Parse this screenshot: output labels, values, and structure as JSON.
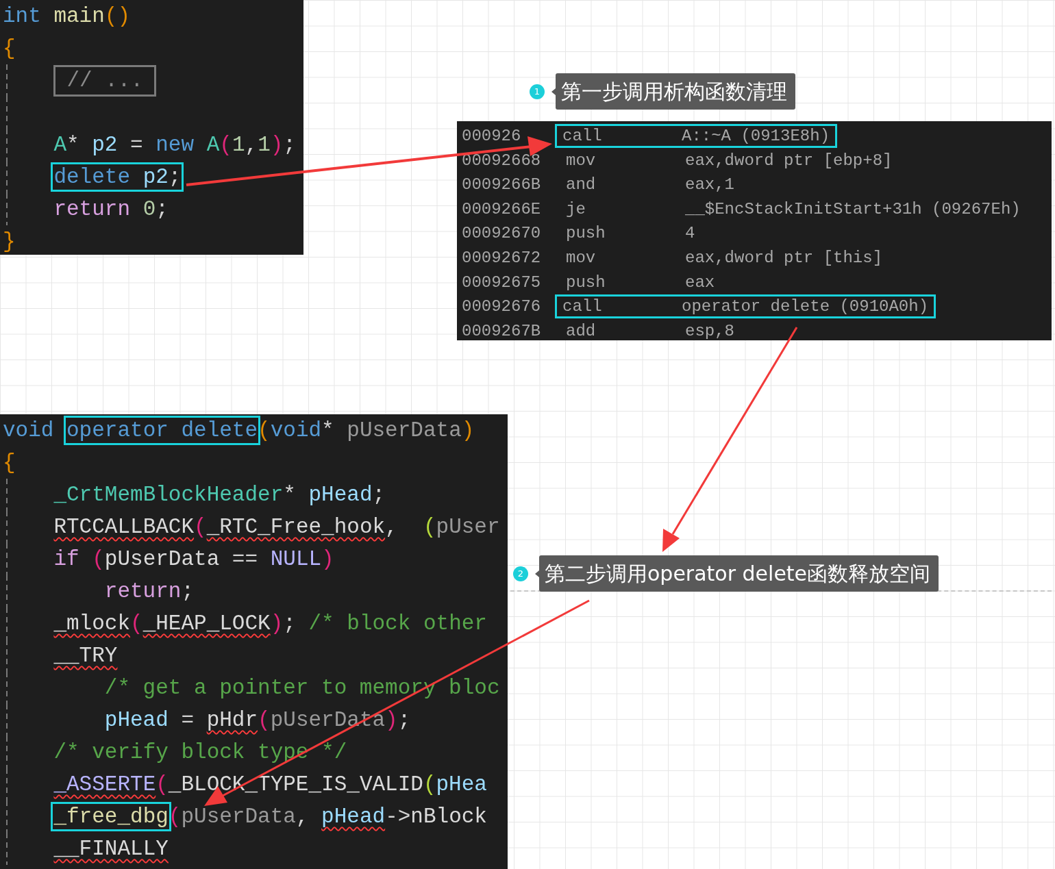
{
  "main_snippet": {
    "lines": [
      {
        "kind": "top",
        "tokens": [
          {
            "text": "int",
            "kind": "keyword"
          },
          {
            "text": " main",
            "kind": "func"
          },
          {
            "text": "()",
            "kind": "paren_orange"
          }
        ]
      },
      {
        "kind": "top",
        "tokens": [
          {
            "text": "{",
            "kind": "brace"
          }
        ]
      },
      {
        "kind": "folded",
        "tokens": [
          {
            "text": "// ...",
            "kind": "folded"
          }
        ]
      },
      {
        "kind": "blank"
      },
      {
        "kind": "body",
        "tokens": [
          {
            "text": "A",
            "kind": "type"
          },
          {
            "text": "* ",
            "kind": "punct"
          },
          {
            "text": "p2",
            "kind": "var"
          },
          {
            "text": " = ",
            "kind": "punct"
          },
          {
            "text": "new",
            "kind": "keyword"
          },
          {
            "text": " A",
            "kind": "type"
          },
          {
            "text": "(",
            "kind": "paren_pink"
          },
          {
            "text": "1",
            "kind": "number"
          },
          {
            "text": ",",
            "kind": "punct"
          },
          {
            "text": "1",
            "kind": "number"
          },
          {
            "text": ")",
            "kind": "paren_pink"
          },
          {
            "text": ";",
            "kind": "punct"
          }
        ]
      },
      {
        "kind": "body",
        "boxed": true,
        "tokens": [
          {
            "text": "delete",
            "kind": "keyword"
          },
          {
            "text": " p2",
            "kind": "var"
          },
          {
            "text": ";",
            "kind": "punct"
          }
        ]
      },
      {
        "kind": "body",
        "tokens": [
          {
            "text": "return",
            "kind": "control"
          },
          {
            "text": " 0",
            "kind": "number"
          },
          {
            "text": ";",
            "kind": "punct"
          }
        ]
      },
      {
        "kind": "top",
        "tokens": [
          {
            "text": "}",
            "kind": "brace"
          }
        ]
      }
    ]
  },
  "disassembly": {
    "rows": [
      {
        "address": "000926",
        "mnemonic": "call",
        "operand": "A::~A (0913E8h)",
        "highlighted": true
      },
      {
        "address": "00092668",
        "mnemonic": "mov",
        "operand": "eax,dword ptr [ebp+8]",
        "highlighted": false
      },
      {
        "address": "0009266B",
        "mnemonic": "and",
        "operand": "eax,1",
        "highlighted": false
      },
      {
        "address": "0009266E",
        "mnemonic": "je",
        "operand": "__$EncStackInitStart+31h (09267Eh)",
        "highlighted": false
      },
      {
        "address": "00092670",
        "mnemonic": "push",
        "operand": "4",
        "highlighted": false
      },
      {
        "address": "00092672",
        "mnemonic": "mov",
        "operand": "eax,dword ptr [this]",
        "highlighted": false
      },
      {
        "address": "00092675",
        "mnemonic": "push",
        "operand": "eax",
        "highlighted": false
      },
      {
        "address": "00092676",
        "mnemonic": "call",
        "operand": "operator delete (0910A0h)",
        "highlighted": true
      },
      {
        "address": "0009267B",
        "mnemonic": "add",
        "operand": "esp,8",
        "highlighted": false
      }
    ]
  },
  "callouts": [
    {
      "number": "1",
      "text": "第一步调用析构函数清理"
    },
    {
      "number": "2",
      "text": "第二步调用operator delete函数释放空间"
    }
  ],
  "delete_snippet": {
    "lines": [
      {
        "kind": "top",
        "tokens": [
          {
            "text": "void ",
            "kind": "keyword"
          },
          {
            "text": "operator delete",
            "kind": "keyword",
            "boxed": true
          },
          {
            "text": "(",
            "kind": "paren_orange"
          },
          {
            "text": "void",
            "kind": "keyword"
          },
          {
            "text": "* ",
            "kind": "punct"
          },
          {
            "text": "pUserData",
            "kind": "param"
          },
          {
            "text": ")",
            "kind": "paren_orange"
          }
        ]
      },
      {
        "kind": "top",
        "tokens": [
          {
            "text": "{",
            "kind": "brace"
          }
        ]
      },
      {
        "kind": "body",
        "tokens": [
          {
            "text": "_CrtMemBlockHeader",
            "kind": "type"
          },
          {
            "text": "* ",
            "kind": "punct"
          },
          {
            "text": "pHead",
            "kind": "var"
          },
          {
            "text": ";",
            "kind": "punct"
          }
        ]
      },
      {
        "kind": "body",
        "tokens": [
          {
            "text": "RTCCALLBACK",
            "kind": "macro",
            "squiggle": true
          },
          {
            "text": "(",
            "kind": "paren_pink"
          },
          {
            "text": "_RTC_Free_hook",
            "kind": "macro",
            "squiggle": true
          },
          {
            "text": ",  ",
            "kind": "punct"
          },
          {
            "text": "(",
            "kind": "paren_green"
          },
          {
            "text": "pUser",
            "kind": "param"
          }
        ]
      },
      {
        "kind": "body",
        "tokens": [
          {
            "text": "if ",
            "kind": "control"
          },
          {
            "text": "(",
            "kind": "paren_pink"
          },
          {
            "text": "pUserData",
            "kind": "macro"
          },
          {
            "text": " == ",
            "kind": "punct"
          },
          {
            "text": "NULL",
            "kind": "constant"
          },
          {
            "text": ")",
            "kind": "paren_pink"
          }
        ]
      },
      {
        "kind": "inner",
        "tokens": [
          {
            "text": "return",
            "kind": "control"
          },
          {
            "text": ";",
            "kind": "punct"
          }
        ]
      },
      {
        "kind": "body",
        "tokens": [
          {
            "text": "_mlock",
            "kind": "macro",
            "squiggle": true
          },
          {
            "text": "(",
            "kind": "paren_pink"
          },
          {
            "text": "_HEAP_LOCK",
            "kind": "macro",
            "squiggle": true
          },
          {
            "text": ")",
            "kind": "paren_pink"
          },
          {
            "text": "; ",
            "kind": "punct"
          },
          {
            "text": "/* block other",
            "kind": "comment"
          }
        ]
      },
      {
        "kind": "body",
        "tokens": [
          {
            "text": "__TRY",
            "kind": "macro",
            "squiggle": true
          }
        ]
      },
      {
        "kind": "inner",
        "tokens": [
          {
            "text": "/* get a pointer to memory bloc",
            "kind": "comment"
          }
        ]
      },
      {
        "kind": "inner",
        "tokens": [
          {
            "text": "pHead",
            "kind": "var"
          },
          {
            "text": " = ",
            "kind": "punct"
          },
          {
            "text": "pHdr",
            "kind": "macro",
            "squiggle": true
          },
          {
            "text": "(",
            "kind": "paren_pink"
          },
          {
            "text": "pUserData",
            "kind": "param"
          },
          {
            "text": ")",
            "kind": "paren_pink"
          },
          {
            "text": ";",
            "kind": "punct"
          }
        ]
      },
      {
        "kind": "body",
        "tokens": [
          {
            "text": "/* verify block type */",
            "kind": "comment"
          }
        ]
      },
      {
        "kind": "body",
        "tokens": [
          {
            "text": "_ASSERTE",
            "kind": "constant",
            "squiggle": true
          },
          {
            "text": "(",
            "kind": "paren_pink"
          },
          {
            "text": "_BLOCK_TYPE_IS_VALID",
            "kind": "macro"
          },
          {
            "text": "(",
            "kind": "paren_green"
          },
          {
            "text": "pHea",
            "kind": "var"
          }
        ]
      },
      {
        "kind": "body",
        "tokens": [
          {
            "text": "_free_dbg",
            "kind": "func",
            "boxed": true
          },
          {
            "text": "(",
            "kind": "paren_pink"
          },
          {
            "text": "pUserData",
            "kind": "param"
          },
          {
            "text": ", ",
            "kind": "punct"
          },
          {
            "text": "pHead",
            "kind": "var",
            "squiggle": true
          },
          {
            "text": "->",
            "kind": "punct"
          },
          {
            "text": "nBlock",
            "kind": "macro"
          }
        ]
      },
      {
        "kind": "body",
        "tokens": [
          {
            "text": "__FINALLY",
            "kind": "macro",
            "squiggle": true
          }
        ]
      }
    ]
  }
}
